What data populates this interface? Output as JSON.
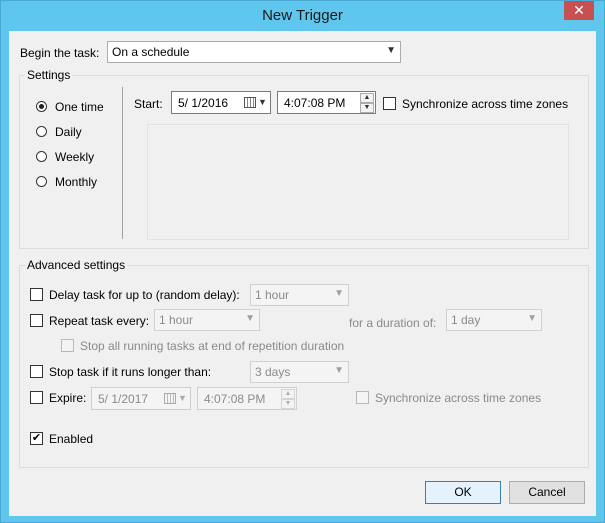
{
  "window": {
    "title": "New Trigger",
    "close_glyph": "✕"
  },
  "begin": {
    "label": "Begin the task:",
    "value": "On a schedule"
  },
  "settings": {
    "group_label": "Settings",
    "options": [
      "One time",
      "Daily",
      "Weekly",
      "Monthly"
    ],
    "selected": "One time",
    "start_label": "Start:",
    "start_date": "5/  1/2016",
    "start_time": "4:07:08 PM",
    "sync_label": "Synchronize across time zones"
  },
  "advanced": {
    "group_label": "Advanced settings",
    "delay_label": "Delay task for up to (random delay):",
    "delay_value": "1 hour",
    "repeat_label": "Repeat task every:",
    "repeat_value": "1 hour",
    "duration_label": "for a duration of:",
    "duration_value": "1 day",
    "stop_all_label": "Stop all running tasks at end of repetition duration",
    "stop_long_label": "Stop task if it runs longer than:",
    "stop_long_value": "3 days",
    "expire_label": "Expire:",
    "expire_date": "5/  1/2017",
    "expire_time": "4:07:08 PM",
    "expire_sync_label": "Synchronize across time zones",
    "enabled_label": "Enabled",
    "enabled_check": "✔",
    "enabled_checked": true
  },
  "buttons": {
    "ok": "OK",
    "cancel": "Cancel"
  },
  "icons": {
    "calendar": "calendar-icon",
    "dropdown": "chevron-down-icon",
    "spin_up": "spin-up-icon",
    "spin_down": "spin-down-icon"
  },
  "colors": {
    "title_bar": "#5fc6ee",
    "close_button": "#c75050",
    "default_button_border": "#3c7fb1"
  }
}
